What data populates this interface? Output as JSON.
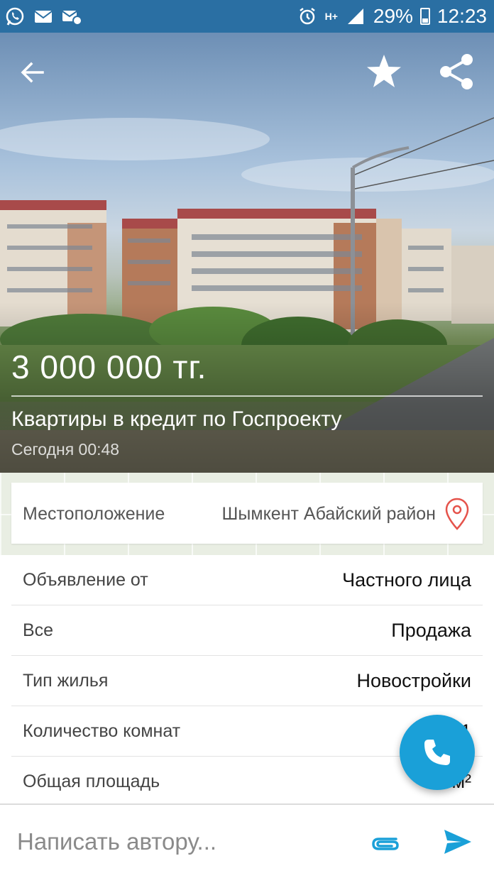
{
  "status_bar": {
    "left_icons": [
      "whatsapp-icon",
      "mail-icon",
      "mail-settings-icon"
    ],
    "right_icons": [
      "alarm-icon",
      "network-icon",
      "signal-icon",
      "battery-icon"
    ],
    "network_type": "H+",
    "battery": "29%",
    "time": "12:23",
    "color": "#2a6fa3"
  },
  "hero": {
    "price": "3 000 000 тг.",
    "title": "Квартиры в кредит по Госпроекту",
    "date": "Сегодня 00:48"
  },
  "location": {
    "label": "Местоположение",
    "value": "Шымкент Абайский район",
    "pin_color": "#e5534b"
  },
  "details": [
    {
      "label": "Объявление от",
      "value": "Частного лица"
    },
    {
      "label": "Все",
      "value": "Продажа"
    },
    {
      "label": "Тип жилья",
      "value": "Новостройки"
    },
    {
      "label": "Количество комнат",
      "value": "1"
    },
    {
      "label": "Общая площадь",
      "value": "м²"
    }
  ],
  "fab": {
    "icon": "phone-icon",
    "color": "#1aa0d8"
  },
  "composer": {
    "placeholder": "Написать автору...",
    "accent": "#1aa0d8"
  }
}
